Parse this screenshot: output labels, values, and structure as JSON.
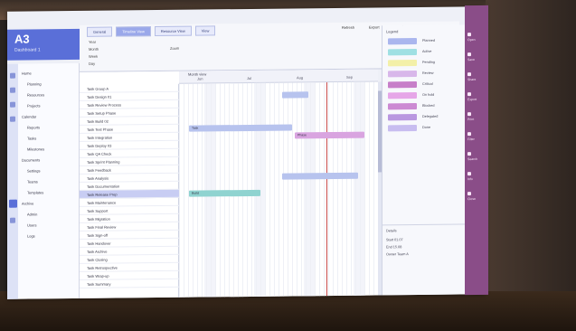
{
  "app": {
    "title": "A3",
    "subtitle": "Dashboard 1"
  },
  "ribbon": {
    "tabs": [
      "General",
      "Timeline View",
      "Resource View",
      "View"
    ],
    "controls": [
      "Year",
      "Month",
      "Week",
      "Day",
      "Zoom"
    ],
    "buttons": [
      "Refresh",
      "Export",
      "Settings",
      "Help"
    ]
  },
  "nav": {
    "items": [
      "Home",
      "Planning",
      "Resources",
      "Projects",
      "Calendar",
      "Reports",
      "Tasks",
      "Milestones",
      "Documents",
      "Settings",
      "Teams",
      "Templates",
      "Archive",
      "Admin",
      "Users",
      "Logs"
    ]
  },
  "timeline": {
    "range_label": "Month view",
    "months": [
      "Jun",
      "Jul",
      "Aug",
      "Sep"
    ]
  },
  "rows": [
    "Task Group A",
    "Task Design 01",
    "Task Review Process",
    "Task Setup Phase",
    "Task Build 02",
    "Task Test Phase",
    "Task Integration",
    "Task Deploy 03",
    "Task QA Check",
    "Task Sprint Planning",
    "Task Feedback",
    "Task Analysis",
    "Task Documentation",
    "Task Release Prep",
    "Task Maintenance",
    "Task Support",
    "Task Migration",
    "Task Final Review",
    "Task Sign-off",
    "Task Handover",
    "Task Archive",
    "Task Closing",
    "Task Retrospective",
    "Task Wrap-up",
    "Task Summary"
  ],
  "selected_row": 13,
  "bars": [
    {
      "row": 1,
      "start": 0.52,
      "end": 0.65,
      "color": "#b7c3ee",
      "label": ""
    },
    {
      "row": 5,
      "start": 0.05,
      "end": 0.57,
      "color": "#b7c3ee",
      "label": "Task"
    },
    {
      "row": 6,
      "start": 0.58,
      "end": 0.93,
      "color": "#d9a4e0",
      "label": "Phase"
    },
    {
      "row": 11,
      "start": 0.52,
      "end": 0.9,
      "color": "#b7c3ee",
      "label": ""
    },
    {
      "row": 13,
      "start": 0.05,
      "end": 0.41,
      "color": "#8fd3d0",
      "label": "Build"
    }
  ],
  "legend": {
    "title": "Legend",
    "items": [
      {
        "color": "#aab6ee",
        "label": "Planned"
      },
      {
        "color": "#9fe0e3",
        "label": "Active"
      },
      {
        "color": "#f3f0a8",
        "label": "Pending"
      },
      {
        "color": "#d8b7ea",
        "label": "Review"
      },
      {
        "color": "#c77fc9",
        "label": "Critical"
      },
      {
        "color": "#e6a6e8",
        "label": "On hold"
      },
      {
        "color": "#cc8ad3",
        "label": "Blocked"
      },
      {
        "color": "#b997e0",
        "label": "Delegated"
      },
      {
        "color": "#c8bdf0",
        "label": "Done"
      }
    ],
    "detail": [
      "Details",
      "Start  01.07",
      "End    15.08",
      "Owner  Team A"
    ]
  },
  "side_panel": {
    "items": [
      "Open",
      "Save",
      "Share",
      "Export",
      "Print",
      "Filter",
      "Search",
      "Info",
      "Close"
    ]
  },
  "colors": {
    "accent": "#5a6fd8",
    "today_line": "#c94a4a",
    "side_panel": "#8a4d88"
  }
}
